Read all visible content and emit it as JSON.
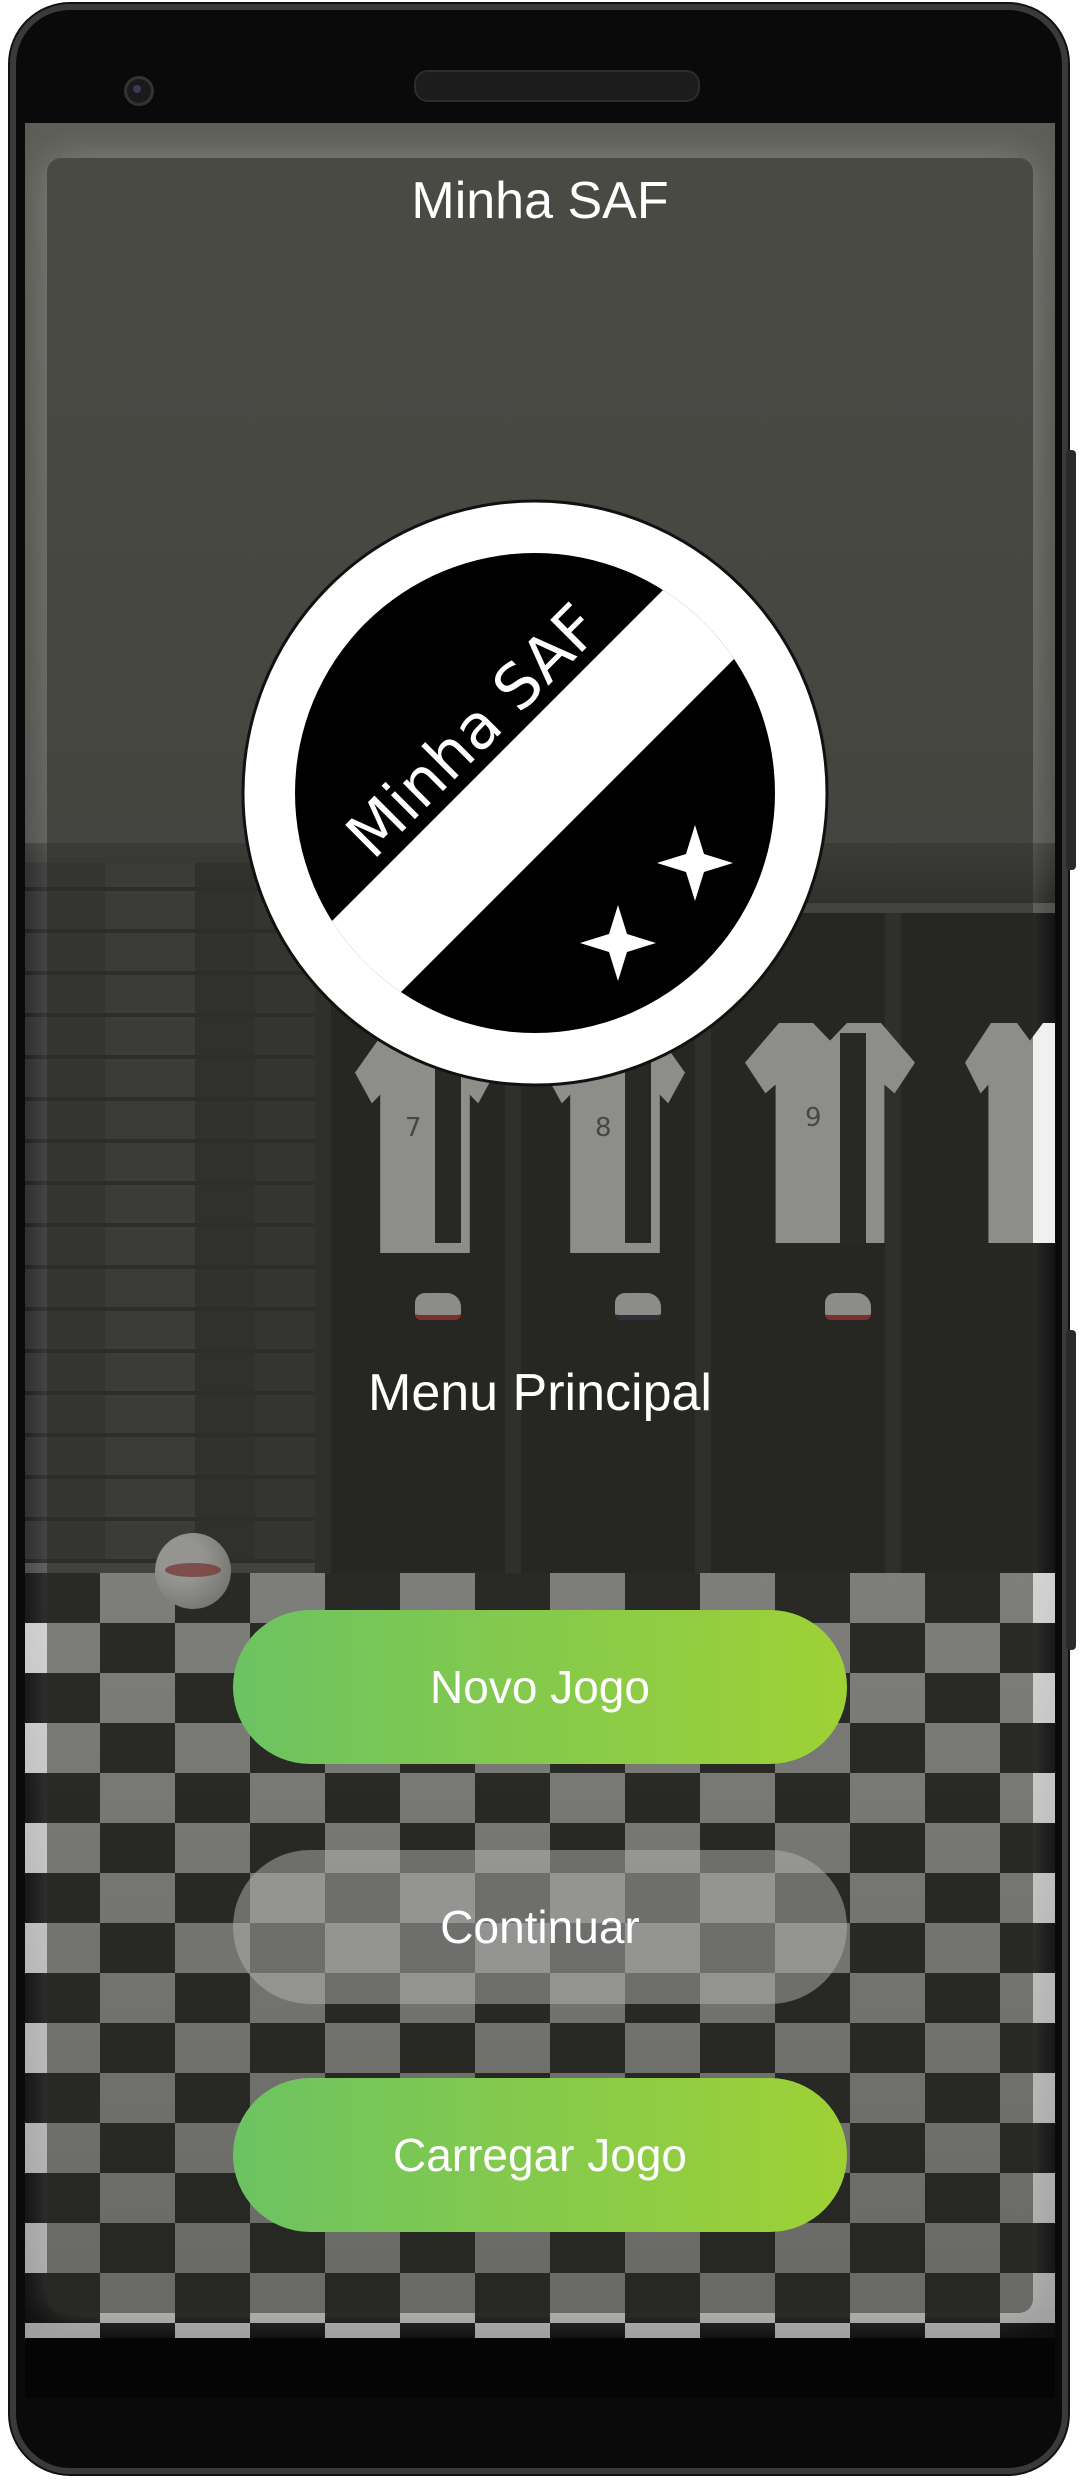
{
  "app": {
    "title": "Minha SAF"
  },
  "logo": {
    "text": "Minha SAF"
  },
  "menu": {
    "label": "Menu Principal",
    "buttons": [
      {
        "label": "Novo Jogo",
        "color": "#7ec84a"
      },
      {
        "label": "Continuar",
        "color": "#9a9a9a"
      },
      {
        "label": "Carregar Jogo",
        "color": "#7ec84a"
      }
    ]
  },
  "background": {
    "shirt_numbers": [
      "7",
      "8",
      "9"
    ]
  }
}
